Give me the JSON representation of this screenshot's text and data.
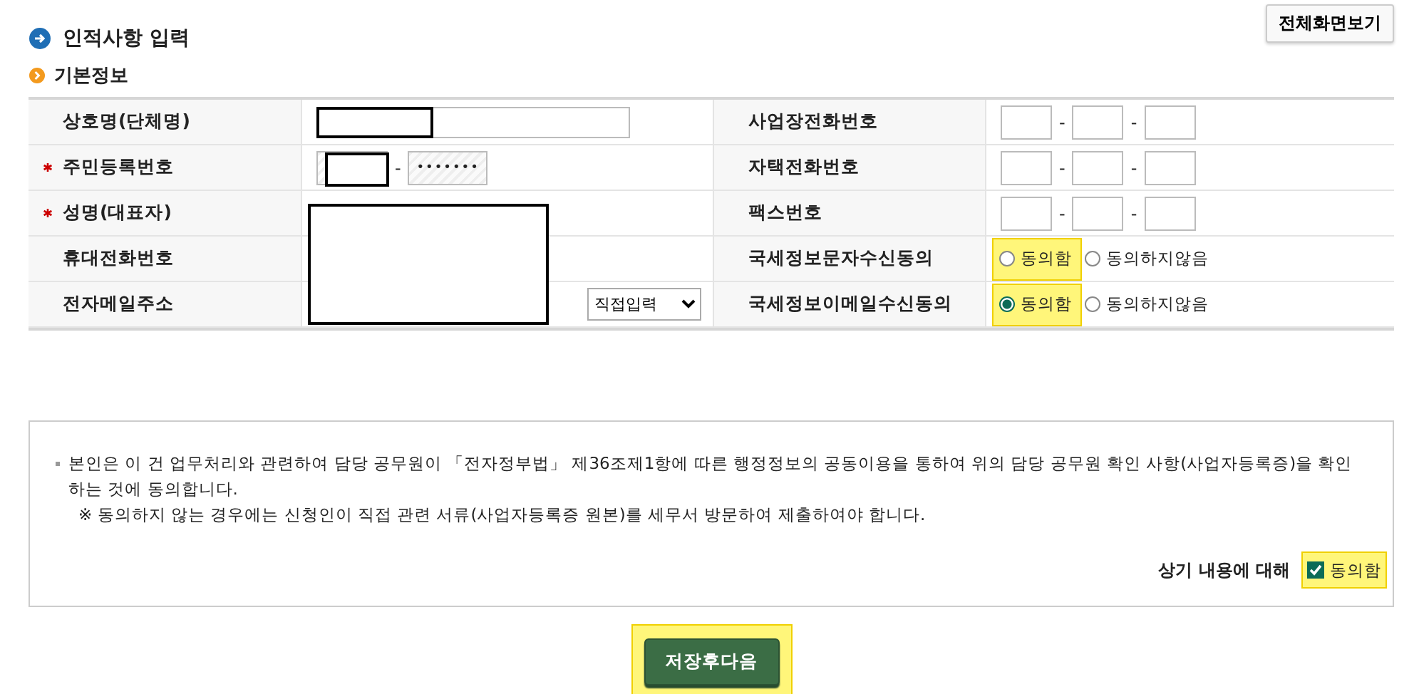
{
  "header": {
    "title": "인적사항 입력",
    "fullscreen_button": "전체화면보기"
  },
  "section": {
    "title": "기본정보"
  },
  "left_rows": [
    {
      "label": "상호명(단체명)",
      "required": false,
      "kind": "text"
    },
    {
      "label": "주민등록번호",
      "required": true,
      "kind": "ssn",
      "separator": "-",
      "masked": "•••••••"
    },
    {
      "label": "성명(대표자)",
      "required": true,
      "kind": "covered"
    },
    {
      "label": "휴대전화번호",
      "required": false,
      "kind": "covered"
    },
    {
      "label": "전자메일주소",
      "required": false,
      "kind": "email",
      "select": "직접입력"
    }
  ],
  "right_rows": [
    {
      "label": "사업장전화번호",
      "kind": "phone",
      "separators": [
        "-",
        "-"
      ]
    },
    {
      "label": "자택전화번호",
      "kind": "phone",
      "separators": [
        "-",
        "-"
      ]
    },
    {
      "label": "팩스번호",
      "kind": "phone",
      "separators": [
        "-",
        "-"
      ]
    },
    {
      "label": "국세정보문자수신동의",
      "kind": "radio",
      "options": [
        {
          "label": "동의함",
          "selected": false,
          "highlighted": true
        },
        {
          "label": "동의하지않음",
          "selected": false,
          "highlighted": false
        }
      ]
    },
    {
      "label": "국세정보이메일수신동의",
      "kind": "radio",
      "options": [
        {
          "label": "동의함",
          "selected": true,
          "highlighted": true
        },
        {
          "label": "동의하지않음",
          "selected": false,
          "highlighted": false
        }
      ]
    }
  ],
  "consent": {
    "paragraphs": [
      "본인은 이 건 업무처리와 관련하여 담당 공무원이 「전자정부법」 제36조제1항에 따른 행정정보의 공동이용을 통하여 위의 담당 공무원 확인 사항(사업자등록증)을 확인하는 것에 동의합니다.",
      "※  동의하지 않는 경우에는 신청인이 직접 관련 서류(사업자등록증 원본)를 세무서 방문하여 제출하여야 합니다."
    ],
    "prompt": "상기 내용에 대해",
    "checkbox": {
      "label": "동의함",
      "checked": true,
      "highlighted": true
    }
  },
  "save_button": {
    "label": "저장후다음",
    "highlighted": true
  }
}
